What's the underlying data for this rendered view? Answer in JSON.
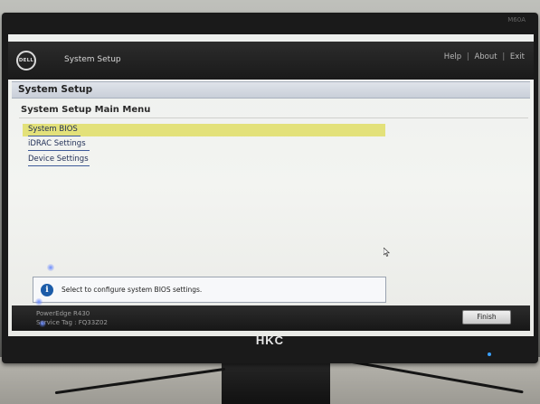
{
  "monitor": {
    "brand": "HKC",
    "bezel_label": "M60A"
  },
  "header": {
    "logo_text": "DELL",
    "title": "System Setup",
    "links": {
      "help": "Help",
      "about": "About",
      "exit": "Exit",
      "separator": "|"
    }
  },
  "section_title": "System Setup",
  "menu": {
    "title": "System Setup Main Menu",
    "items": [
      {
        "label": "System BIOS",
        "selected": true
      },
      {
        "label": "iDRAC Settings",
        "selected": false
      },
      {
        "label": "Device Settings",
        "selected": false
      }
    ]
  },
  "help": {
    "icon": "info-icon",
    "icon_glyph": "i",
    "text": "Select to configure system BIOS settings."
  },
  "footer": {
    "model": "PowerEdge R430",
    "service_tag": "Service Tag : FQ33Z02",
    "finish_label": "Finish"
  },
  "colors": {
    "selection": "#e3e17a",
    "topbar": "#1f1f1f",
    "link": "#1f2d55",
    "info_icon": "#1c5ca8"
  }
}
